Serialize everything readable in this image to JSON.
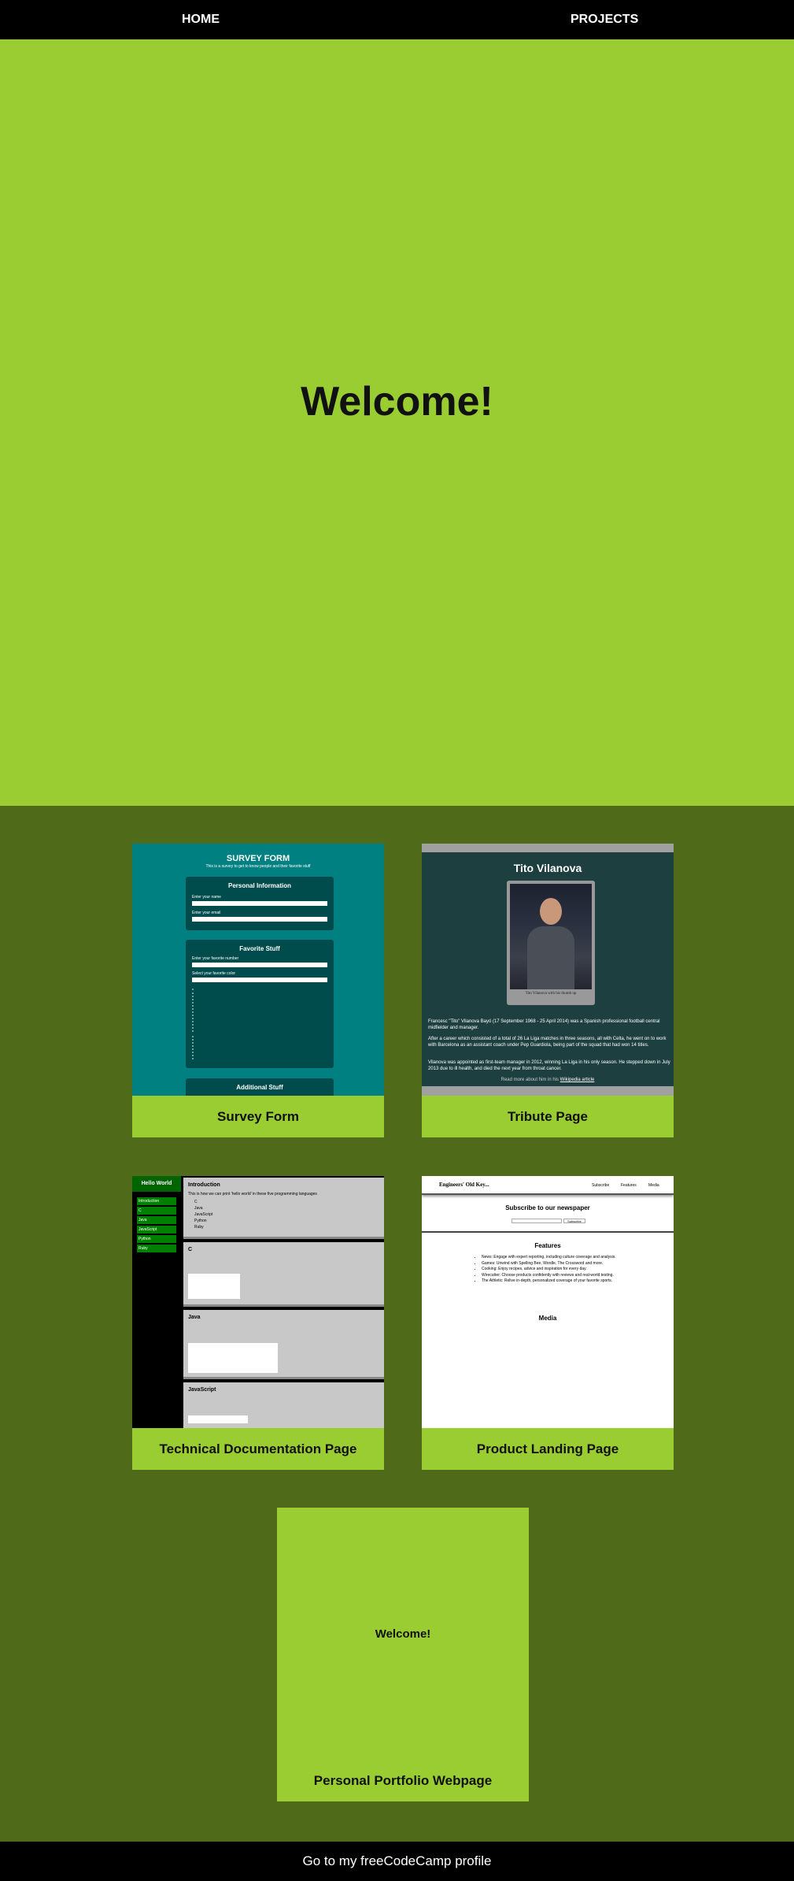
{
  "nav": {
    "home": "HOME",
    "projects": "PROJECTS"
  },
  "hero": {
    "title": "Welcome!"
  },
  "projects": [
    {
      "label": "Survey Form"
    },
    {
      "label": "Tribute Page"
    },
    {
      "label": "Technical Documentation Page"
    },
    {
      "label": "Product Landing Page"
    },
    {
      "label": "Personal Portfolio Webpage"
    }
  ],
  "survey_preview": {
    "title": "SURVEY FORM",
    "subtitle": "This is a survey to get to know people and their favorite stuff",
    "section1": "Personal Information",
    "name_label": "Enter your name",
    "email_label": "Enter your email",
    "section2": "Favorite Stuff",
    "fav_number_label": "Enter your favorite number",
    "fav_color_label": "Select your favorite color",
    "section3": "Additional Stuff"
  },
  "tribute_preview": {
    "title": "Tito Vilanova",
    "img_caption": "Tito Vilanova with his thumb up",
    "p1": "Francesc \"Tito\" Vilanova Bayó (17 September 1968 - 25 April 2014) was a Spanish professional football central midfielder and manager.",
    "p2": "After a career which consisted of a total of 26 La Liga matches in three seasons, all with Celta, he went on to work with Barcelona as an assistant coach under Pep Guardiola, being part of the squad that had won 14 titles.",
    "p3": "Vilanova was appointed as first-team manager in 2012, winning La Liga in his only season. He stepped down in July 2013 due to ill health, and died the next year from throat cancer.",
    "more": "Read more about him in his",
    "link": "Wikipedia article"
  },
  "docs_preview": {
    "sidebar_title": "Hello World",
    "sidebar_items": [
      "Introduction",
      "C",
      "Java",
      "JavaScript",
      "Python",
      "Ruby"
    ],
    "intro_title": "Introduction",
    "intro_text": "This is how we can print 'hello world' in these five programming languages",
    "intro_list": [
      "C",
      "Java",
      "JavaScript",
      "Python",
      "Ruby"
    ],
    "c_title": "C",
    "java_title": "Java",
    "js_title": "JavaScript"
  },
  "landing_preview": {
    "brand": "Engineers' Old Key...",
    "links": [
      "Subscribe",
      "Features",
      "Media"
    ],
    "subscribe_title": "Subscribe to our newspaper",
    "subscribe_button": "Subscribe",
    "features_title": "Features",
    "features": [
      "News: Engage with expert reporting, including culture coverage and analysis.",
      "Games: Unwind with Spelling Bee, Wordle, The Crossword and more.",
      "Cooking: Enjoy recipes, advice and inspiration for every day.",
      "Wirecutter: Choose products confidently with reviews and real-world testing.",
      "The Athletic: Relive in-depth, personalized coverage of your favorite sports."
    ],
    "media_title": "Media"
  },
  "portfolio_preview": {
    "title": "Welcome!"
  },
  "footer": {
    "text": "Go to my freeCodeCamp profile"
  },
  "colors": {
    "accent": "#9acd32",
    "background": "#4f6b1a",
    "nav": "#000000",
    "survey_teal": "#008080",
    "tribute_dark": "#1e3f3f"
  }
}
